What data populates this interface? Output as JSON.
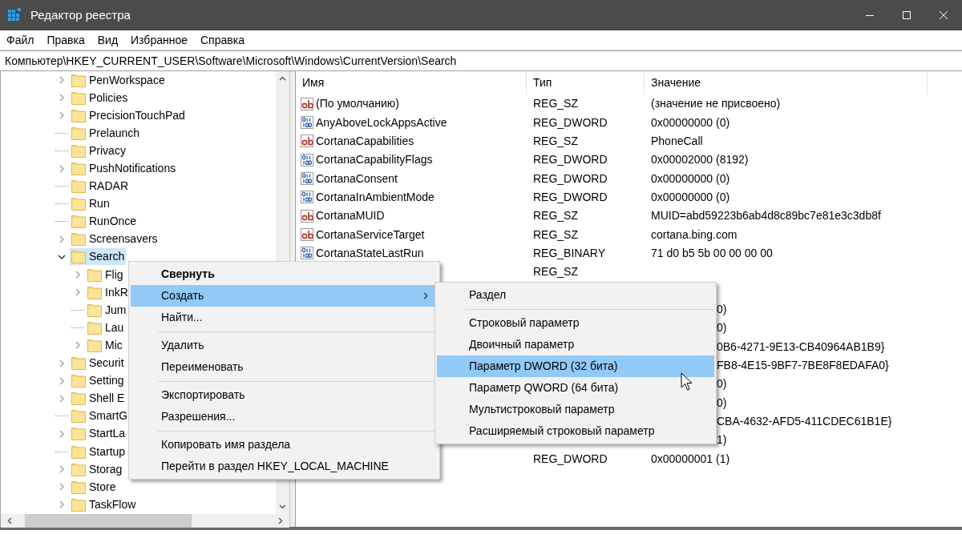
{
  "window": {
    "title": "Редактор реестра"
  },
  "menu": [
    "Файл",
    "Правка",
    "Вид",
    "Избранное",
    "Справка"
  ],
  "address": "Компьютер\\HKEY_CURRENT_USER\\Software\\Microsoft\\Windows\\CurrentVersion\\Search",
  "tree": [
    {
      "label": "PenWorkspace",
      "kind": "branch",
      "expanded": false,
      "selected": false
    },
    {
      "label": "Policies",
      "kind": "branch",
      "expanded": false,
      "selected": false
    },
    {
      "label": "PrecisionTouchPad",
      "kind": "branch",
      "expanded": false,
      "selected": false
    },
    {
      "label": "Prelaunch",
      "kind": "leaf",
      "selected": false
    },
    {
      "label": "Privacy",
      "kind": "leaf",
      "selected": false
    },
    {
      "label": "PushNotifications",
      "kind": "branch",
      "expanded": false,
      "selected": false
    },
    {
      "label": "RADAR",
      "kind": "leaf",
      "selected": false
    },
    {
      "label": "Run",
      "kind": "leaf",
      "selected": false
    },
    {
      "label": "RunOnce",
      "kind": "leaf",
      "selected": false
    },
    {
      "label": "Screensavers",
      "kind": "branch",
      "expanded": false,
      "selected": false
    },
    {
      "label": "Search",
      "kind": "branch",
      "expanded": true,
      "selected": true,
      "children": [
        {
          "label": "Flig",
          "kind": "branch",
          "expanded": false,
          "selected": false
        },
        {
          "label": "InkR",
          "kind": "branch",
          "expanded": false,
          "selected": false
        },
        {
          "label": "Jum",
          "kind": "leaf",
          "selected": false
        },
        {
          "label": "Lau",
          "kind": "leaf",
          "selected": false
        },
        {
          "label": "Mic",
          "kind": "branch",
          "expanded": false,
          "selected": false
        }
      ]
    },
    {
      "label": "Securit",
      "kind": "branch",
      "expanded": false,
      "selected": false
    },
    {
      "label": "Setting",
      "kind": "branch",
      "expanded": false,
      "selected": false
    },
    {
      "label": "Shell E",
      "kind": "branch",
      "expanded": false,
      "selected": false
    },
    {
      "label": "SmartG",
      "kind": "leaf",
      "selected": false
    },
    {
      "label": "StartLa",
      "kind": "branch",
      "expanded": false,
      "selected": false
    },
    {
      "label": "Startup",
      "kind": "leaf",
      "selected": false
    },
    {
      "label": "Storag",
      "kind": "branch",
      "expanded": false,
      "selected": false
    },
    {
      "label": "Store",
      "kind": "branch",
      "expanded": false,
      "selected": false
    },
    {
      "label": "TaskFlow",
      "kind": "branch",
      "expanded": false,
      "selected": false
    }
  ],
  "table": {
    "columns": [
      "Имя",
      "Тип",
      "Значение"
    ],
    "rows": [
      {
        "kind": "string",
        "name": "(По умолчанию)",
        "type": "REG_SZ",
        "value": "(значение не присвоено)"
      },
      {
        "kind": "binary",
        "name": "AnyAboveLockAppsActive",
        "type": "REG_DWORD",
        "value": "0x00000000 (0)"
      },
      {
        "kind": "string",
        "name": "CortanaCapabilities",
        "type": "REG_SZ",
        "value": "PhoneCall"
      },
      {
        "kind": "binary",
        "name": "CortanaCapabilityFlags",
        "type": "REG_DWORD",
        "value": "0x00002000 (8192)"
      },
      {
        "kind": "binary",
        "name": "CortanaConsent",
        "type": "REG_DWORD",
        "value": "0x00000000 (0)"
      },
      {
        "kind": "binary",
        "name": "CortanaInAmbientMode",
        "type": "REG_DWORD",
        "value": "0x00000000 (0)"
      },
      {
        "kind": "string",
        "name": "CortanaMUID",
        "type": "REG_SZ",
        "value": "MUID=abd59223b6ab4d8c89bc7e81e3c3db8f"
      },
      {
        "kind": "string",
        "name": "CortanaServiceTarget",
        "type": "REG_SZ",
        "value": "cortana.bing.com"
      },
      {
        "kind": "binary",
        "name": "CortanaStateLastRun",
        "type": "REG_BINARY",
        "value": "71 d0 b5 5b 00 00 00 00"
      },
      {
        "kind": "under_menu",
        "type": "REG_SZ"
      },
      {
        "kind": "under_submenu"
      },
      {
        "kind": "under_submenu",
        "value": "0)"
      },
      {
        "kind": "under_submenu",
        "value": "0)"
      },
      {
        "kind": "under_submenu",
        "value": "0B6-4271-9E13-CB40964AB1B9}"
      },
      {
        "kind": "under_submenu",
        "value": "FB8-4E15-9BF7-7BE8F8EDAFA0}"
      },
      {
        "kind": "under_submenu",
        "value": "0)"
      },
      {
        "kind": "under_submenu",
        "value": "0)"
      },
      {
        "kind": "under_submenu",
        "value": "CBA-4632-AFD5-411CDEC61B1E}"
      },
      {
        "kind": "under_submenu",
        "value": "1)"
      },
      {
        "kind": "under_menu",
        "type": "REG_DWORD",
        "value": "0x00000001 (1)"
      }
    ]
  },
  "context_menu": {
    "items": [
      {
        "kind": "item",
        "label": "Свернуть",
        "bold": true,
        "submenu": false,
        "selected": false
      },
      {
        "kind": "item",
        "label": "Создать",
        "bold": false,
        "submenu": true,
        "selected": true
      },
      {
        "kind": "item",
        "label": "Найти...",
        "bold": false,
        "submenu": false,
        "selected": false
      },
      {
        "kind": "separator"
      },
      {
        "kind": "item",
        "label": "Удалить",
        "bold": false,
        "submenu": false,
        "selected": false
      },
      {
        "kind": "item",
        "label": "Переименовать",
        "bold": false,
        "submenu": false,
        "selected": false
      },
      {
        "kind": "separator"
      },
      {
        "kind": "item",
        "label": "Экспортировать",
        "bold": false,
        "submenu": false,
        "selected": false
      },
      {
        "kind": "item",
        "label": "Разрешения...",
        "bold": false,
        "submenu": false,
        "selected": false
      },
      {
        "kind": "separator"
      },
      {
        "kind": "item",
        "label": "Копировать имя раздела",
        "bold": false,
        "submenu": false,
        "selected": false
      },
      {
        "kind": "item",
        "label": "Перейти в раздел HKEY_LOCAL_MACHINE",
        "bold": false,
        "submenu": false,
        "selected": false
      }
    ]
  },
  "submenu": {
    "items": [
      {
        "kind": "item",
        "label": "Раздел",
        "selected": false
      },
      {
        "kind": "separator"
      },
      {
        "kind": "item",
        "label": "Строковый параметр",
        "selected": false
      },
      {
        "kind": "item",
        "label": "Двоичный параметр",
        "selected": false
      },
      {
        "kind": "item",
        "label": "Параметр DWORD (32 бита)",
        "selected": true
      },
      {
        "kind": "item",
        "label": "Параметр QWORD (64 бита)",
        "selected": false
      },
      {
        "kind": "item",
        "label": "Мультистроковый параметр",
        "selected": false
      },
      {
        "kind": "item",
        "label": "Расширяемый строковый параметр",
        "selected": false
      }
    ]
  }
}
